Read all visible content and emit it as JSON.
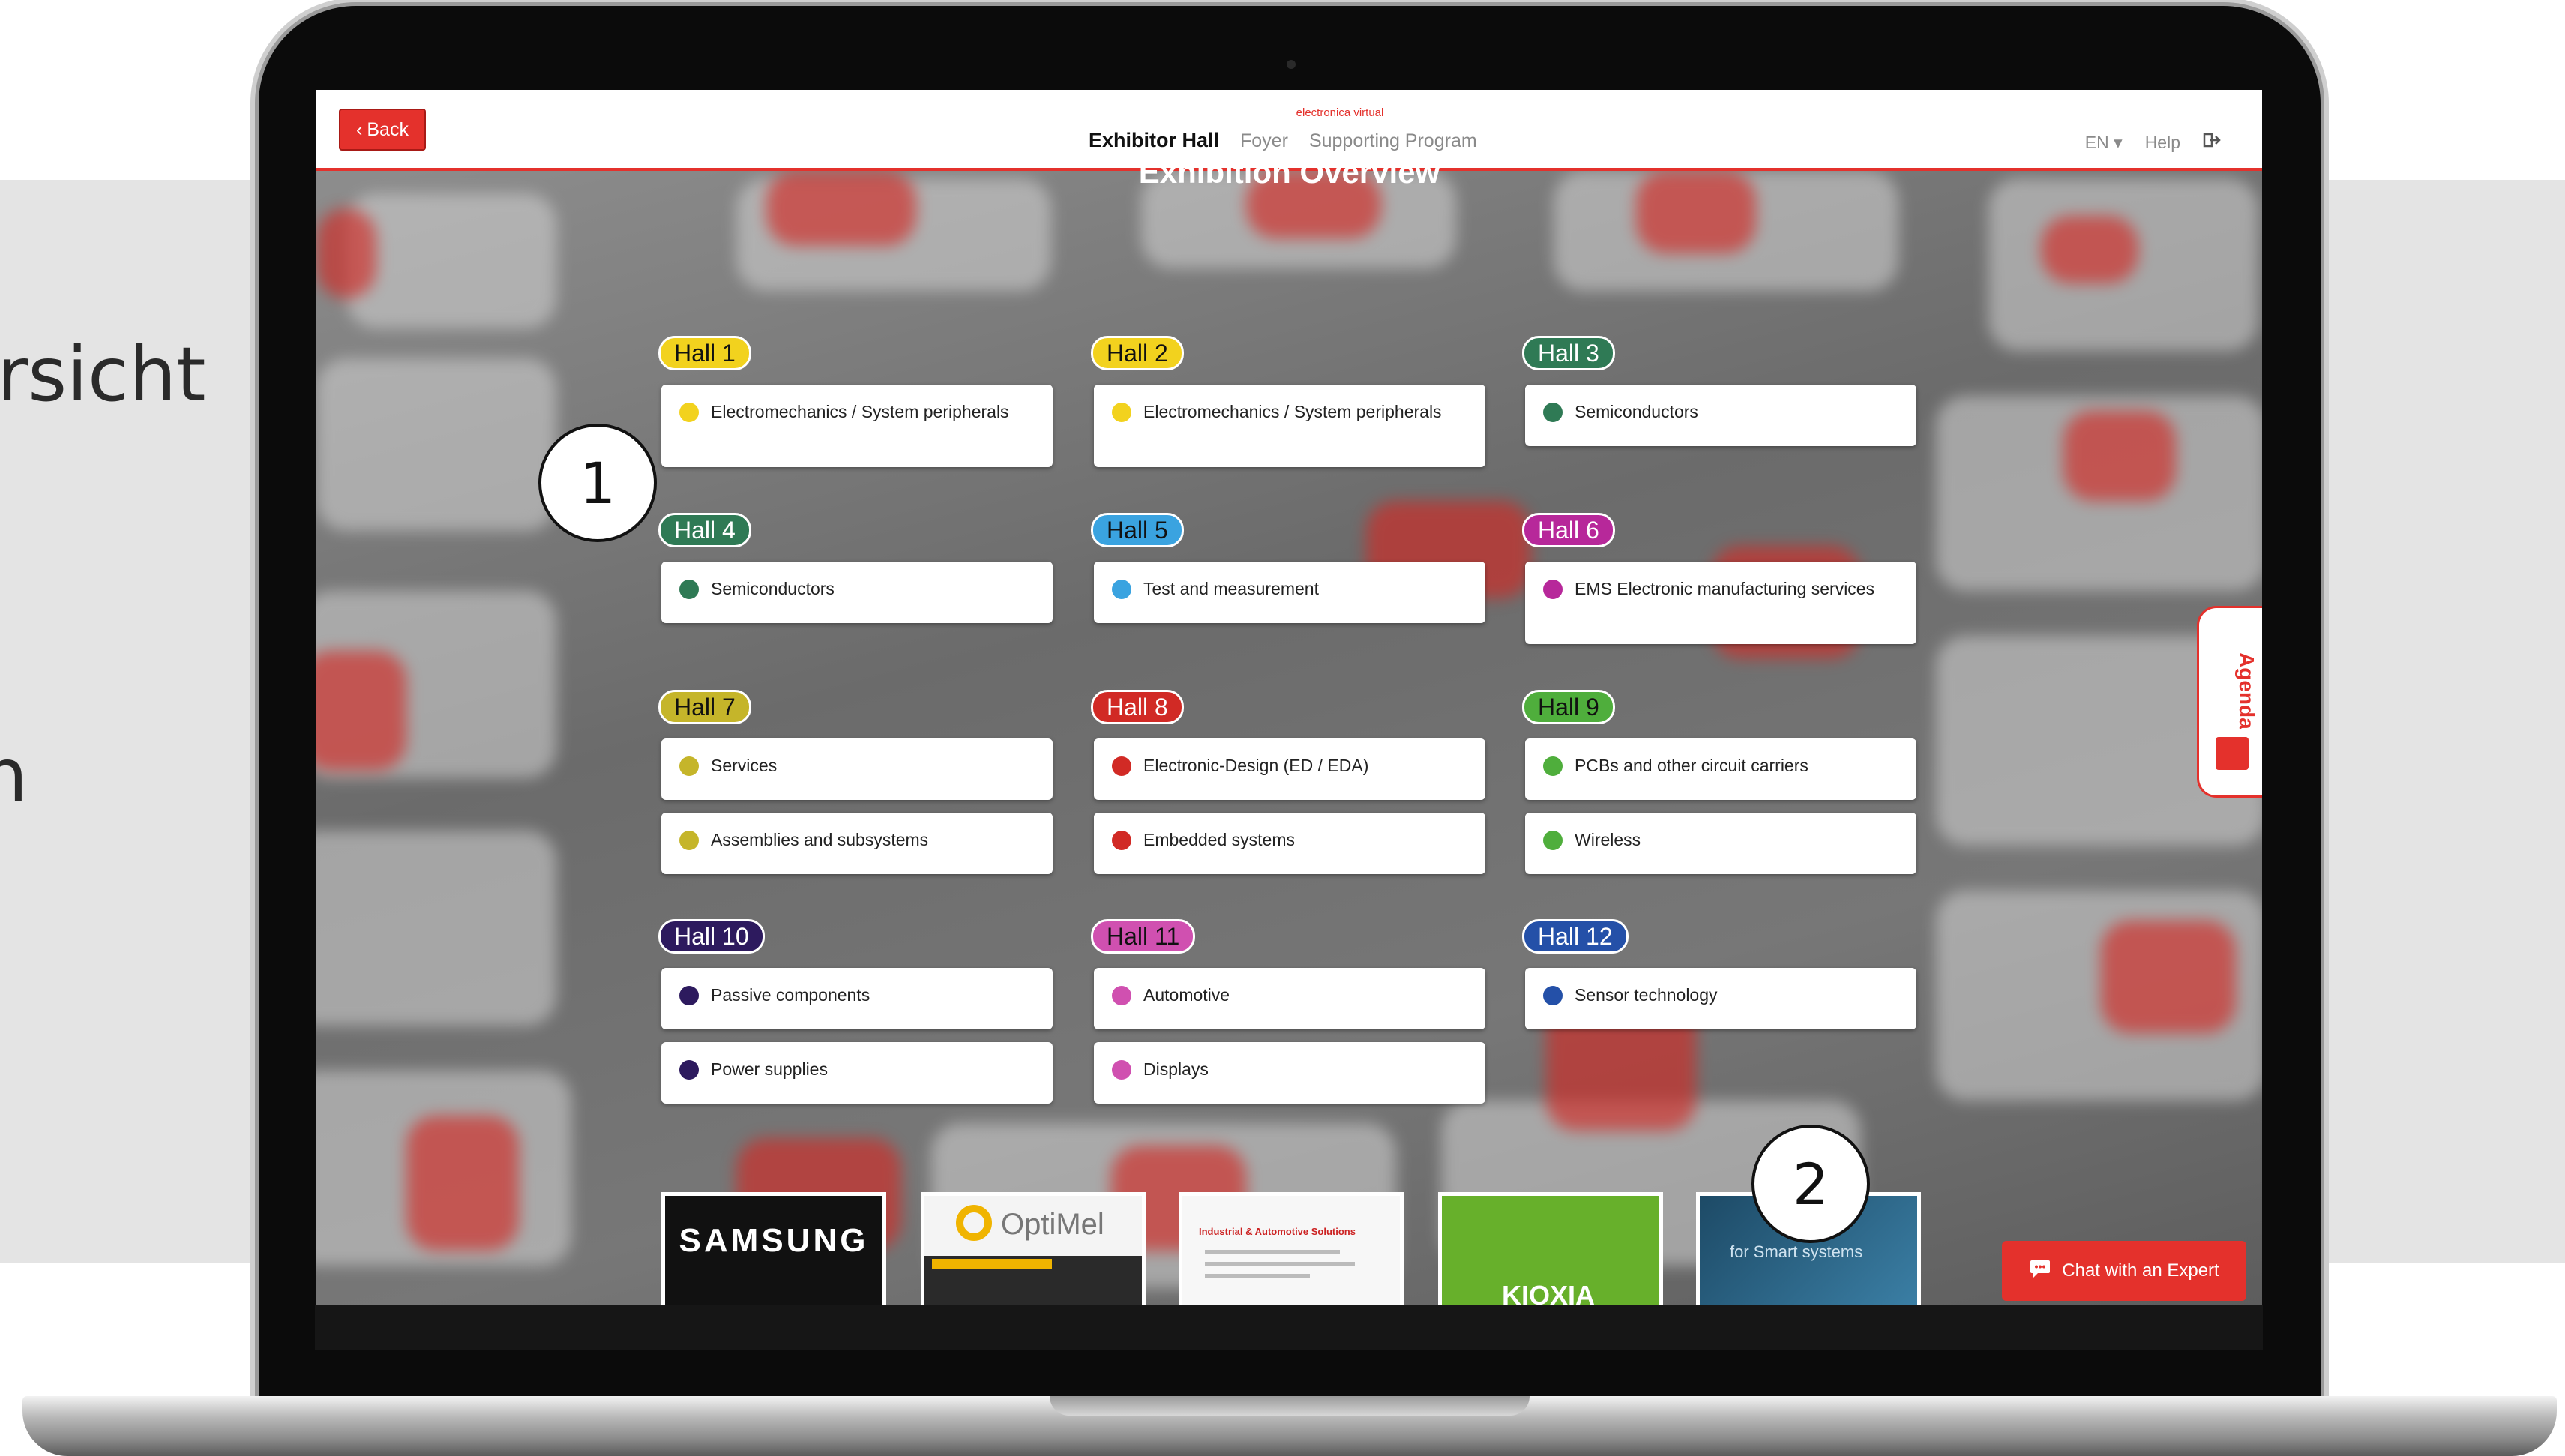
{
  "side_text": {
    "line1": "rsicht",
    "line2": "n"
  },
  "topbar": {
    "back_label": "Back",
    "brand": "electronica virtual",
    "nav": [
      "Exhibitor Hall",
      "Foyer",
      "Supporting Program"
    ],
    "lang": "EN",
    "help": "Help"
  },
  "title": "Exhibition Overview",
  "halls": [
    {
      "name": "Hall 1",
      "color": "#f2d21e",
      "text_color": "#111111",
      "items": [
        {
          "label": "Electromechanics / System peripherals"
        }
      ]
    },
    {
      "name": "Hall 2",
      "color": "#f2d21e",
      "text_color": "#111111",
      "items": [
        {
          "label": "Electromechanics / System peripherals"
        }
      ]
    },
    {
      "name": "Hall 3",
      "color": "#2f7a55",
      "text_color": "#ffffff",
      "items": [
        {
          "label": "Semiconductors"
        }
      ]
    },
    {
      "name": "Hall 4",
      "color": "#2f7a55",
      "text_color": "#ffffff",
      "items": [
        {
          "label": "Semiconductors"
        }
      ]
    },
    {
      "name": "Hall 5",
      "color": "#3aa3e0",
      "text_color": "#111111",
      "items": [
        {
          "label": "Test and measurement"
        }
      ]
    },
    {
      "name": "Hall 6",
      "color": "#b7289a",
      "text_color": "#ffffff",
      "items": [
        {
          "label": "EMS Electronic manufacturing services"
        }
      ]
    },
    {
      "name": "Hall 7",
      "color": "#c5b52a",
      "text_color": "#111111",
      "items": [
        {
          "label": "Services"
        },
        {
          "label": "Assemblies and subsystems"
        }
      ]
    },
    {
      "name": "Hall 8",
      "color": "#d12a25",
      "text_color": "#ffffff",
      "items": [
        {
          "label": "Electronic-Design (ED / EDA)"
        },
        {
          "label": "Embedded systems"
        }
      ]
    },
    {
      "name": "Hall 9",
      "color": "#4fae3c",
      "text_color": "#111111",
      "items": [
        {
          "label": "PCBs and other circuit carriers"
        },
        {
          "label": "Wireless"
        }
      ]
    },
    {
      "name": "Hall 10",
      "color": "#2d1a5e",
      "text_color": "#ffffff",
      "items": [
        {
          "label": "Passive components"
        },
        {
          "label": "Power supplies"
        }
      ]
    },
    {
      "name": "Hall 11",
      "color": "#d050b0",
      "text_color": "#111111",
      "items": [
        {
          "label": "Automotive"
        },
        {
          "label": "Displays"
        }
      ]
    },
    {
      "name": "Hall 12",
      "color": "#2450a8",
      "text_color": "#ffffff",
      "items": [
        {
          "label": "Sensor technology"
        }
      ]
    }
  ],
  "thumbnails": [
    {
      "label": "SAMSUNG"
    },
    {
      "label": "OptiMel"
    },
    {
      "label": "Industrial & Automotive Solutions"
    },
    {
      "label": "KIOXIA"
    },
    {
      "label": "for Smart systems"
    }
  ],
  "agenda_label": "Agenda",
  "chat_label": "Chat with an Expert",
  "callouts": [
    "1",
    "2"
  ]
}
